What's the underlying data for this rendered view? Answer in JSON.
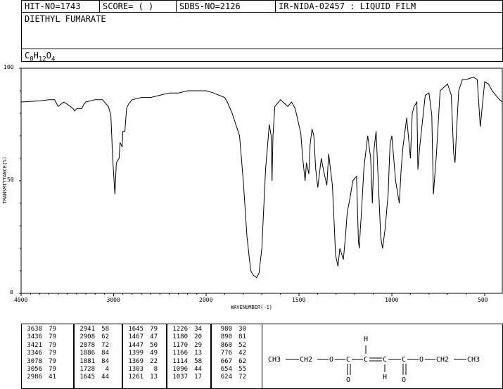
{
  "header": {
    "hit_no": "HIT-NO=1743",
    "score": "SCORE=  (   )",
    "sdbs_no": "SDBS-NO=2126",
    "method": "IR-NIDA-02457 : LIQUID FILM"
  },
  "compound": {
    "name": "DIETHYL FUMARATE",
    "formula_parts": [
      {
        "t": "C",
        "sub": false
      },
      {
        "t": "8",
        "sub": true
      },
      {
        "t": "H",
        "sub": false
      },
      {
        "t": "12",
        "sub": true
      },
      {
        "t": "O",
        "sub": false
      },
      {
        "t": "4",
        "sub": true
      }
    ]
  },
  "axes": {
    "xlabel": "WAVENUMBER(-1)",
    "ylabel": "TRANSMITTANCE(%)"
  },
  "chart_data": {
    "type": "line",
    "title": "DIETHYL FUMARATE",
    "xlabel": "WAVENUMBER(-1)",
    "ylabel": "TRANSMITTANCE(%)",
    "xlim": [
      4000,
      400
    ],
    "ylim": [
      0,
      100
    ],
    "x_reversed": true,
    "x_ticks": [
      4000,
      3000,
      2000,
      1500,
      1000,
      500
    ],
    "y_ticks": [
      0,
      50,
      100
    ],
    "grid": false,
    "series": [
      {
        "x": [
          4000,
          3800,
          3700,
          3638,
          3600,
          3540,
          3500,
          3436,
          3421,
          3400,
          3346,
          3320,
          3300,
          3200,
          3120,
          3078,
          3056,
          3030,
          3010,
          2986,
          2970,
          2941,
          2930,
          2908,
          2900,
          2878,
          2860,
          2840,
          2800,
          2700,
          2600,
          2500,
          2400,
          2300,
          2200,
          2100,
          2000,
          1960,
          1900,
          1886,
          1860,
          1820,
          1800,
          1780,
          1760,
          1745,
          1728,
          1715,
          1700,
          1680,
          1660,
          1650,
          1645,
          1640,
          1630,
          1600,
          1560,
          1540,
          1520,
          1490,
          1480,
          1467,
          1460,
          1447,
          1440,
          1430,
          1420,
          1410,
          1399,
          1380,
          1369,
          1350,
          1340,
          1320,
          1310,
          1303,
          1290,
          1280,
          1261,
          1250,
          1240,
          1226,
          1210,
          1190,
          1180,
          1175,
          1170,
          1166,
          1150,
          1130,
          1114,
          1105,
          1096,
          1085,
          1060,
          1050,
          1037,
          1020,
          1010,
          1000,
          980,
          960,
          950,
          940,
          920,
          900,
          890,
          880,
          865,
          860,
          850,
          820,
          800,
          785,
          776,
          760,
          740,
          700,
          680,
          667,
          660,
          654,
          640,
          620,
          600,
          560,
          540,
          524,
          500,
          480,
          460,
          440,
          420,
          400
        ],
        "y": [
          85,
          85.5,
          86,
          86,
          83,
          85,
          84,
          82,
          81,
          82,
          82,
          84,
          85,
          86,
          86,
          84,
          83,
          79,
          60,
          44,
          58,
          60,
          67,
          65,
          72,
          72,
          82,
          84,
          86,
          87,
          87,
          88,
          89,
          89,
          90,
          90,
          90,
          89,
          87,
          85,
          80,
          70,
          50,
          25,
          10,
          8,
          7,
          9,
          20,
          55,
          75,
          70,
          50,
          70,
          83,
          86,
          83,
          85,
          82,
          71,
          60,
          50,
          58,
          53,
          66,
          73,
          70,
          55,
          47,
          60,
          55,
          48,
          62,
          48,
          30,
          17,
          12,
          20,
          15,
          25,
          36,
          42,
          50,
          52,
          23,
          20,
          28,
          33,
          56,
          70,
          60,
          40,
          64,
          72,
          25,
          20,
          28,
          44,
          66,
          70,
          50,
          40,
          55,
          65,
          78,
          60,
          80,
          83,
          85,
          55,
          65,
          88,
          89,
          79,
          44,
          62,
          90,
          93,
          88,
          62,
          58,
          68,
          90,
          95,
          95,
          96,
          95,
          74,
          94,
          93,
          90,
          88,
          86,
          85
        ]
      }
    ]
  },
  "peak_table": [
    {
      "wn": "3638",
      "t": "79"
    },
    {
      "wn": "3436",
      "t": "79"
    },
    {
      "wn": "3421",
      "t": "79"
    },
    {
      "wn": "3346",
      "t": "79"
    },
    {
      "wn": "3078",
      "t": "79"
    },
    {
      "wn": "3056",
      "t": "79"
    },
    {
      "wn": "2986",
      "t": "41"
    },
    {
      "wn": "2941",
      "t": "58"
    },
    {
      "wn": "2908",
      "t": "62"
    },
    {
      "wn": "2878",
      "t": "72"
    },
    {
      "wn": "1886",
      "t": "84"
    },
    {
      "wn": "1881",
      "t": "84"
    },
    {
      "wn": "1728",
      "t": "4"
    },
    {
      "wn": "1645",
      "t": "44"
    },
    {
      "wn": "1645",
      "t": "79"
    },
    {
      "wn": "1467",
      "t": "47"
    },
    {
      "wn": "1447",
      "t": "50"
    },
    {
      "wn": "1399",
      "t": "49"
    },
    {
      "wn": "1369",
      "t": "22"
    },
    {
      "wn": "1303",
      "t": "8"
    },
    {
      "wn": "1261",
      "t": "13"
    },
    {
      "wn": "1226",
      "t": "34"
    },
    {
      "wn": "1180",
      "t": "20"
    },
    {
      "wn": "1170",
      "t": "29"
    },
    {
      "wn": "1166",
      "t": "13"
    },
    {
      "wn": "1114",
      "t": "58"
    },
    {
      "wn": "1096",
      "t": "44"
    },
    {
      "wn": "1037",
      "t": "17"
    },
    {
      "wn": "980",
      "t": "30"
    },
    {
      "wn": "890",
      "t": "81"
    },
    {
      "wn": "860",
      "t": "52"
    },
    {
      "wn": "776",
      "t": "42"
    },
    {
      "wn": "667",
      "t": "62"
    },
    {
      "wn": "654",
      "t": "55"
    },
    {
      "wn": "624",
      "t": "72"
    }
  ],
  "structure": {
    "ch3_left": "CH3",
    "ch2_left": "CH2",
    "o1": "O",
    "c1": "C",
    "c2": "C",
    "c3": "C",
    "c4": "C",
    "o2": "O",
    "ch2_right": "CH2",
    "ch3_right": "CH3",
    "h_top": "H",
    "h_bottom": "H",
    "o_carbonyl_left": "O",
    "o_carbonyl_right": "O"
  }
}
